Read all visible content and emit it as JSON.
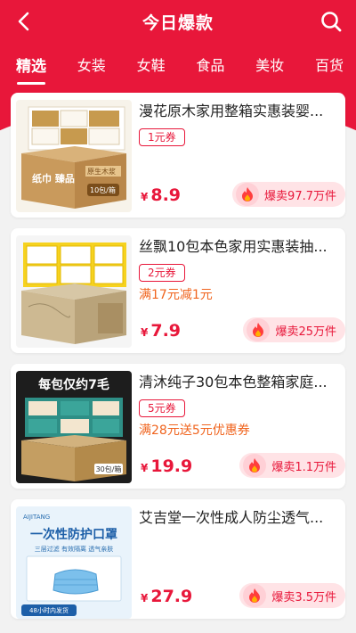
{
  "header": {
    "title": "今日爆款",
    "back_icon": "back-arrow-icon",
    "search_icon": "search-icon",
    "accent_color": "#e8173a"
  },
  "tabs": [
    {
      "label": "精选",
      "active": true
    },
    {
      "label": "女装",
      "active": false
    },
    {
      "label": "女鞋",
      "active": false
    },
    {
      "label": "食品",
      "active": false
    },
    {
      "label": "美妆",
      "active": false
    },
    {
      "label": "百货",
      "active": false
    }
  ],
  "products": [
    {
      "name": "漫花原木家用整箱实惠装婴...",
      "coupon": "1元券",
      "promo": "",
      "price": "8.9",
      "yen": "¥",
      "hot": "爆卖97.7万件"
    },
    {
      "name": "丝飘10包本色家用实惠装抽...",
      "coupon": "2元券",
      "promo": "满17元减1元",
      "price": "7.9",
      "yen": "¥",
      "hot": "爆卖25万件"
    },
    {
      "name": "清沐纯子30包本色整箱家庭...",
      "coupon": "5元券",
      "promo": "满28元送5元优惠券",
      "price": "19.9",
      "yen": "¥",
      "hot": "爆卖1.1万件"
    },
    {
      "name": "艾吉堂一次性成人防尘透气...",
      "coupon": "",
      "promo": "",
      "price": "27.9",
      "yen": "¥",
      "hot": "爆卖3.5万件"
    }
  ],
  "images": {
    "p1_box_text": "纸巾 臻品",
    "p1_side_text": "原生木浆",
    "p1_count": "10包/箱",
    "p3_banner": "每包仅约7毛",
    "p3_count": "30包/箱",
    "p4_brand": "AIJITANG",
    "p4_title": "一次性防护口罩",
    "p4_sub": "三层过滤 有效隔离 透气亲肤",
    "p4_footer": "48小时内发货"
  }
}
